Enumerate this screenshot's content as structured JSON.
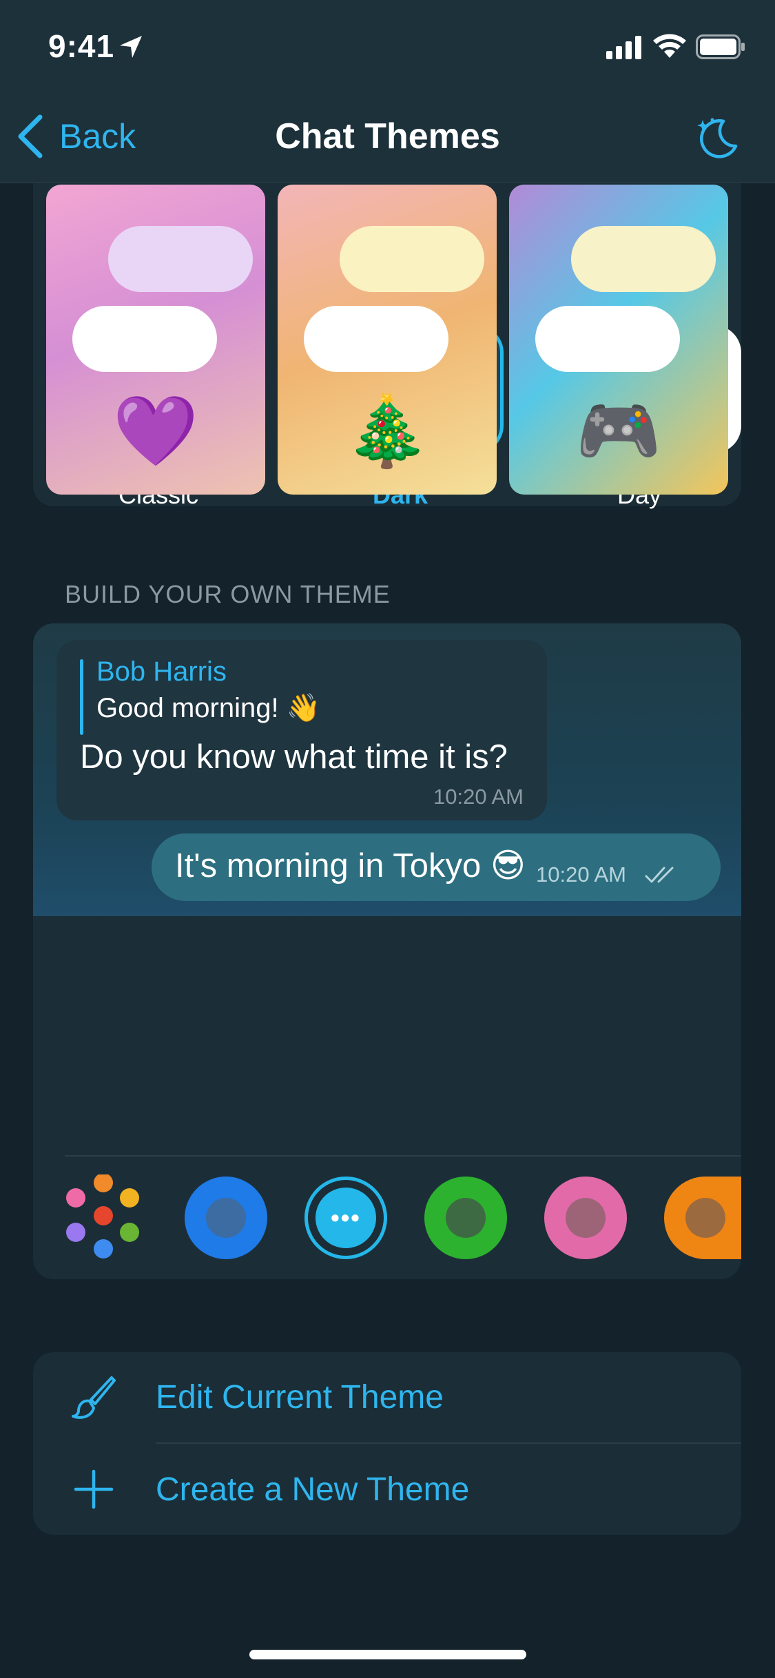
{
  "status_bar": {
    "time": "9:41"
  },
  "nav": {
    "back_label": "Back",
    "title": "Chat Themes"
  },
  "theme_previews": [
    {
      "emoji": "💜",
      "in_bubble_color": "#e9d6f6"
    },
    {
      "emoji": "🎄",
      "in_bubble_color": "#fbf2c2"
    },
    {
      "emoji": "🎮",
      "in_bubble_color": "#f8f2c8"
    }
  ],
  "build": {
    "section_label": "BUILD YOUR OWN THEME",
    "incoming": {
      "reply_name": "Bob Harris",
      "reply_text": "Good morning! 👋",
      "text": "Do you know what time it is?",
      "time": "10:20 AM"
    },
    "outgoing": {
      "text": "It's morning in Tokyo 😎",
      "time": "10:20 AM"
    },
    "backgrounds": [
      {
        "label": "Classic",
        "selected": false
      },
      {
        "label": "Dark",
        "selected": true
      },
      {
        "label": "Day",
        "selected": false
      }
    ],
    "accent_colors": [
      "#1e7be8",
      "#24b7ea",
      "#2cb22f",
      "#e36aa9",
      "#ef8513"
    ],
    "selected_color_glyph": "•••"
  },
  "actions": {
    "edit_label": "Edit Current Theme",
    "create_label": "Create a New Theme"
  }
}
